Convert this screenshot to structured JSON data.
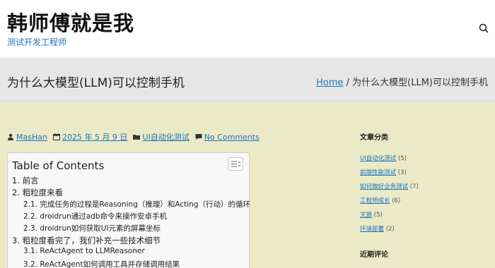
{
  "header": {
    "site_title": "韩师傅就是我",
    "site_description": "测试开发工程师",
    "search_icon": "search-icon"
  },
  "title_bar": {
    "page_title": "为什么大模型(LLM)可以控制手机",
    "breadcrumb": {
      "home": "Home",
      "separator": " / ",
      "current": "为什么大模型(LLM)可以控制手机"
    }
  },
  "meta": {
    "author": "MasHan",
    "date": "2025 年 5 月 9 日",
    "category": "UI自动化测试",
    "comments": "No Comments"
  },
  "toc": {
    "title": "Table of Contents",
    "items": [
      {
        "text": "1. 前言",
        "level": 1
      },
      {
        "text": "2. 粗粒度来看",
        "level": 1
      },
      {
        "text": "2.1. 完成任务的过程是Reasoning（推理）和Acting（行动）的循环",
        "level": 2
      },
      {
        "text": "2.2. droidrun通过adb命令来操作安卓手机",
        "level": 2
      },
      {
        "text": "2.3. droidrun如何获取UI元素的屏幕坐标",
        "level": 2
      },
      {
        "text": "3. 粗粒度看完了，我们补充一些技术细节",
        "level": 1
      },
      {
        "text": "3.1. ReActAgent to LLMReasoner",
        "level": 2
      },
      {
        "text": "3.2. ReActAgent如何调用工具并存储调用结果",
        "level": 2
      }
    ]
  },
  "sidebar": {
    "categories_title": "文章分类",
    "categories": [
      {
        "name": "UI自动化测试",
        "count": "(5)"
      },
      {
        "name": "前端性能测试",
        "count": "(3)"
      },
      {
        "name": "如何做好业务测试",
        "count": "(7)"
      },
      {
        "name": "工程师成长",
        "count": "(6)"
      },
      {
        "name": "文摘",
        "count": "(5)"
      },
      {
        "name": "环境部署",
        "count": "(2)"
      }
    ],
    "recent_comments_title": "近期评论"
  }
}
